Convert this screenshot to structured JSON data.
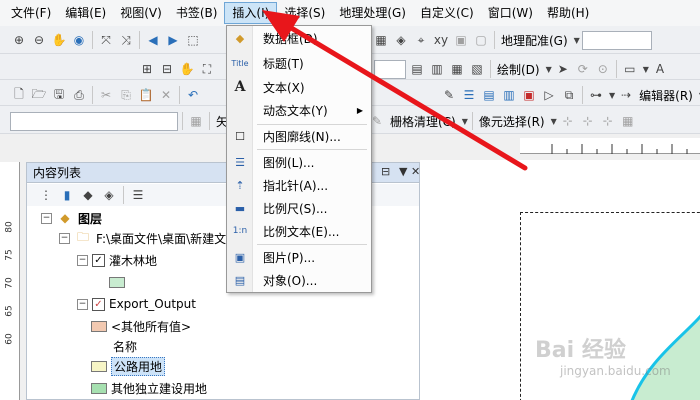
{
  "menubar": {
    "items": [
      "文件(F)",
      "编辑(E)",
      "视图(V)",
      "书签(B)",
      "插入(I)",
      "选择(S)",
      "地理处理(G)",
      "自定义(C)",
      "窗口(W)",
      "帮助(H)"
    ],
    "active_index": 4
  },
  "toolbar": {
    "georef_label": "地理配准(G)",
    "draw_label": "绘制(D)",
    "editor_label": "编辑器(R)",
    "raster_clean_label": "栅格清理(C)",
    "pixel_select_label": "像元选择(R)",
    "partial_label": "矢"
  },
  "insert_menu": {
    "items": [
      {
        "label": "数据框(D)",
        "icon": "data-frame-icon"
      },
      {
        "label": "标题(T)",
        "icon": "title-icon"
      },
      {
        "label": "文本(X)",
        "icon": "text-icon"
      },
      {
        "label": "动态文本(Y)",
        "icon": "",
        "submenu": true
      },
      {
        "label": "内图廓线(N)...",
        "icon": "neatline-icon"
      },
      {
        "label": "图例(L)...",
        "icon": "legend-icon"
      },
      {
        "label": "指北针(A)...",
        "icon": "north-arrow-icon"
      },
      {
        "label": "比例尺(S)...",
        "icon": "scale-bar-icon"
      },
      {
        "label": "比例文本(E)...",
        "icon": "scale-text-icon"
      },
      {
        "label": "图片(P)...",
        "icon": "picture-icon"
      },
      {
        "label": "对象(O)...",
        "icon": "object-icon"
      }
    ]
  },
  "toc": {
    "title": "内容列表",
    "root": "图层",
    "folder": "F:\\桌面文件\\桌面\\新建文",
    "layer1": "灌木林地",
    "layer2": "Export_Output",
    "other_values": "<其他所有值>",
    "heading": "名称",
    "class1": "公路用地",
    "class2": "其他独立建设用地"
  },
  "ruler": {
    "v_ticks": [
      "80",
      "75",
      "70",
      "65",
      "60"
    ]
  },
  "colors": {
    "class_other": "#f2c9b1",
    "class_shrub": "#c8ecd0",
    "class_road": "#f7f5c6",
    "class_building": "#a6e0b0",
    "arrow": "#e8161b"
  },
  "watermark": {
    "main": "Bai 经验",
    "sub": "jingyan.baidu.com"
  }
}
